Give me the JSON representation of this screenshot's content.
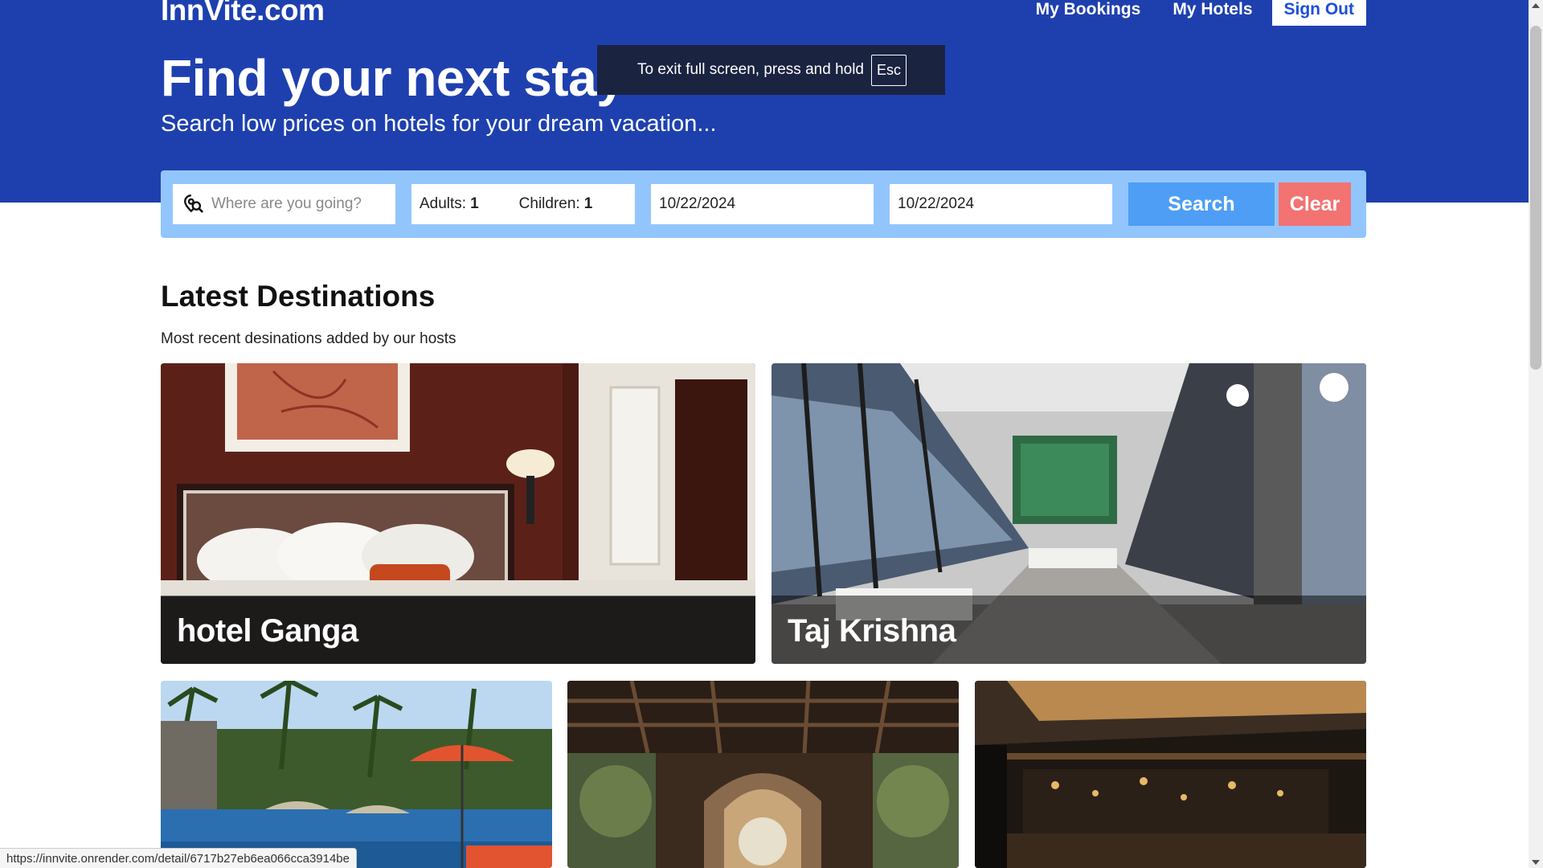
{
  "header": {
    "brand": "InnVite.com",
    "nav": {
      "my_bookings": "My Bookings",
      "my_hotels": "My Hotels",
      "sign_out": "Sign Out"
    },
    "headline": "Find your next stay",
    "subheadline": "Search low prices on hotels for your dream vacation..."
  },
  "fullscreen_toast": {
    "text": "To exit full screen, press and hold",
    "key": "Esc"
  },
  "search": {
    "destination_placeholder": "Where are you going?",
    "destination_value": "",
    "adults_label": "Adults:",
    "adults_value": "1",
    "children_label": "Children:",
    "children_value": "1",
    "check_in": "10/22/2024",
    "check_out": "10/22/2024",
    "search_label": "Search",
    "clear_label": "Clear"
  },
  "latest": {
    "title": "Latest Destinations",
    "subtitle": "Most recent desinations added by our hosts",
    "cards": [
      {
        "name": "hotel Ganga"
      },
      {
        "name": "Taj Krishna"
      },
      {
        "name": ""
      },
      {
        "name": ""
      },
      {
        "name": ""
      }
    ]
  },
  "statusbar": {
    "url": "https://innvite.onrender.com/detail/6717b27eb6ea066cca3914be"
  },
  "colors": {
    "hero_bg": "#1e40af",
    "searchbar_bg": "#93c5fd",
    "search_button": "#4e9ef5",
    "clear_button": "#f37272"
  }
}
